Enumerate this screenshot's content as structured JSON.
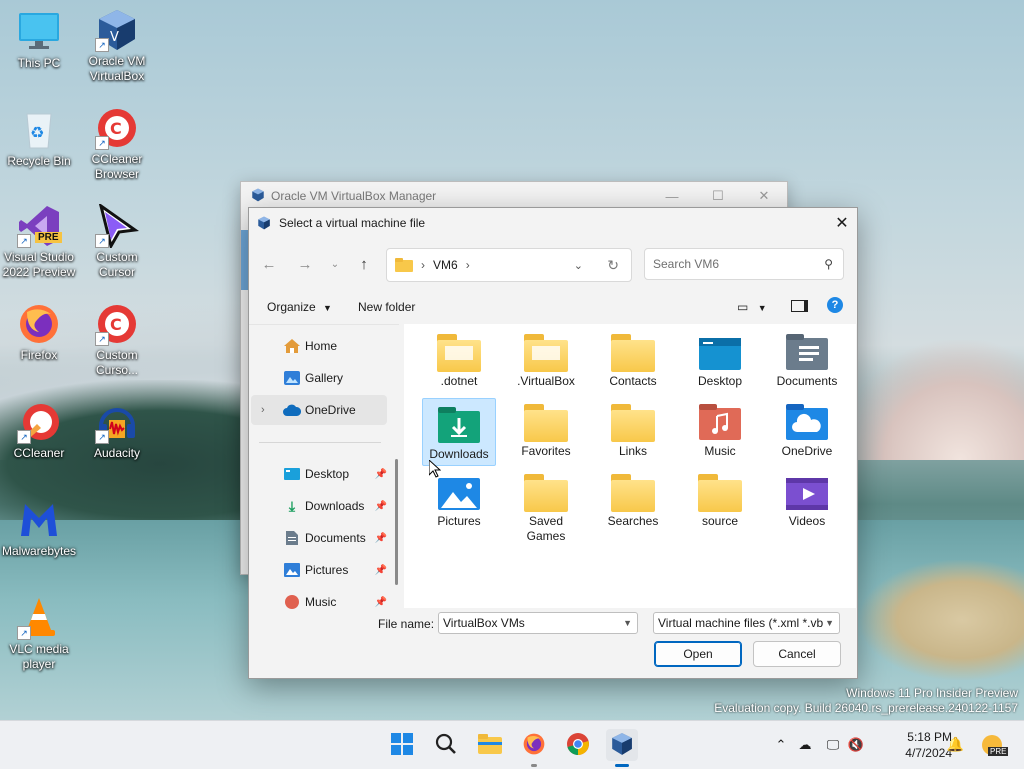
{
  "desktop_icons": [
    {
      "label": "This PC",
      "icon": "monitor-icon"
    },
    {
      "label": "Oracle VM\nVirtualBox",
      "icon": "virtualbox-icon"
    },
    {
      "label": "Recycle Bin",
      "icon": "recycle-bin-icon"
    },
    {
      "label": "CCleaner\nBrowser",
      "icon": "ccleaner-browser-icon"
    },
    {
      "label": "Visual Studio\n2022 Preview",
      "icon": "visual-studio-icon",
      "badge": "PRE"
    },
    {
      "label": "Custom\nCursor",
      "icon": "custom-cursor-icon"
    },
    {
      "label": "Firefox",
      "icon": "firefox-icon"
    },
    {
      "label": "Custom\nCurso...",
      "icon": "custom-cursor-browser-icon"
    },
    {
      "label": "CCleaner",
      "icon": "ccleaner-icon"
    },
    {
      "label": "Audacity",
      "icon": "audacity-icon"
    },
    {
      "label": "Malwarebytes",
      "icon": "malwarebytes-icon"
    },
    {
      "label": "VLC media\nplayer",
      "icon": "vlc-icon"
    }
  ],
  "vbox_manager": {
    "title": "Oracle VM VirtualBox Manager"
  },
  "dialog": {
    "title": "Select a virtual machine file",
    "address": {
      "folder": "VM6",
      "sep1": "›",
      "sep2": "›"
    },
    "search_placeholder": "Search VM6",
    "toolbar": {
      "organize": "Organize",
      "new_folder": "New folder"
    },
    "nav": {
      "home": "Home",
      "gallery": "Gallery",
      "onedrive": "OneDrive",
      "desktop": "Desktop",
      "downloads": "Downloads",
      "documents": "Documents",
      "pictures": "Pictures",
      "music": "Music"
    },
    "files": [
      {
        "label": ".dotnet",
        "type": "folder-doc"
      },
      {
        "label": ".VirtualBox",
        "type": "folder-doc"
      },
      {
        "label": "Contacts",
        "type": "folder"
      },
      {
        "label": "Desktop",
        "type": "desktop"
      },
      {
        "label": "Documents",
        "type": "documents"
      },
      {
        "label": "Downloads",
        "type": "downloads",
        "selected": true
      },
      {
        "label": "Favorites",
        "type": "folder"
      },
      {
        "label": "Links",
        "type": "folder"
      },
      {
        "label": "Music",
        "type": "music"
      },
      {
        "label": "OneDrive",
        "type": "onedrive"
      },
      {
        "label": "Pictures",
        "type": "pictures"
      },
      {
        "label": "Saved\nGames",
        "type": "folder"
      },
      {
        "label": "Searches",
        "type": "folder"
      },
      {
        "label": "source",
        "type": "folder"
      },
      {
        "label": "Videos",
        "type": "videos"
      }
    ],
    "file_name_label": "File name:",
    "file_name_value": "VirtualBox VMs",
    "file_type_value": "Virtual machine files (*.xml *.vb",
    "open_label": "Open",
    "cancel_label": "Cancel"
  },
  "watermark": {
    "line1": "Windows 11 Pro Insider Preview",
    "line2": "Evaluation copy. Build 26040.rs_prerelease.240122-1157"
  },
  "taskbar": {
    "time": "5:18 PM",
    "date": "4/7/2024",
    "badge": "PRE"
  },
  "colors": {
    "accent": "#0067c0",
    "selection": "#cce8ff",
    "folder": "#f8c84a"
  }
}
